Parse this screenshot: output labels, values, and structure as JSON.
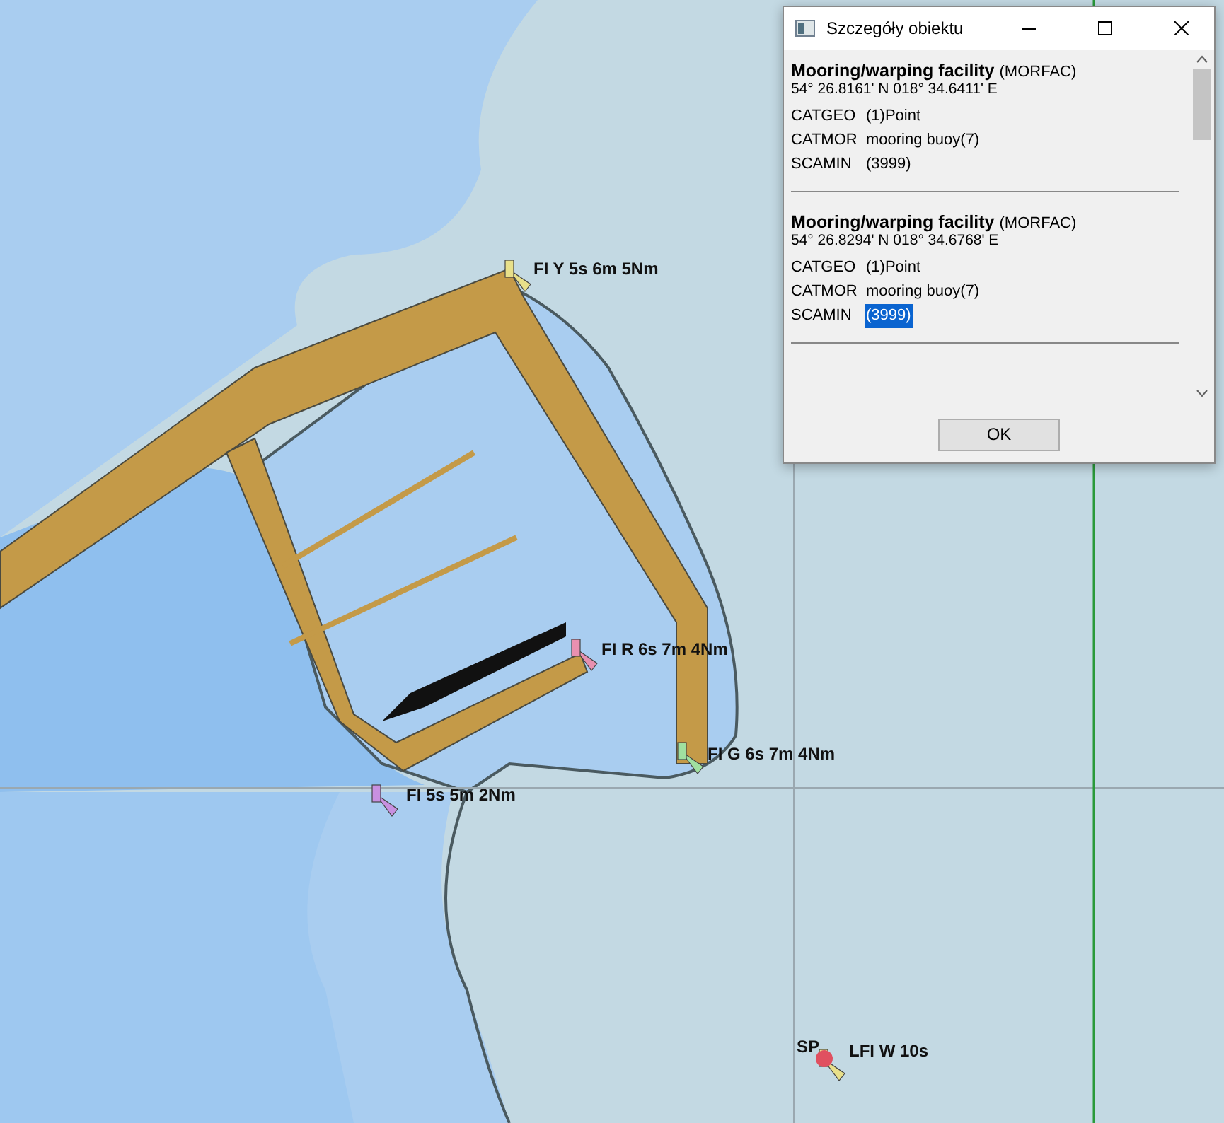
{
  "chart": {
    "lights": [
      {
        "label": "FI Y 5s 6m 5Nm",
        "color": "#e8e08a"
      },
      {
        "label": "FI R 6s 7m 4Nm",
        "color": "#e890b0"
      },
      {
        "label": "FI G 6s 7m 4Nm",
        "color": "#a0e0a0"
      },
      {
        "label": "FI  5s 5m 2Nm",
        "color": "#c890e0"
      },
      {
        "label": "LFI W 10s",
        "color": "#e8e08a"
      }
    ],
    "buoy": {
      "label": "SP",
      "color": "#e05060"
    }
  },
  "dialog": {
    "title": "Szczegóły obiektu",
    "records": [
      {
        "name": "Mooring/warping facility",
        "code": "(MORFAC)",
        "position": "54° 26.8161' N 018° 34.6411' E",
        "attributes": [
          {
            "key": "CATGEO",
            "value": "(1)Point",
            "selected": false
          },
          {
            "key": "CATMOR",
            "value": "mooring buoy(7)",
            "selected": false
          },
          {
            "key": "SCAMIN",
            "value": "(3999)",
            "selected": false
          }
        ]
      },
      {
        "name": "Mooring/warping facility",
        "code": "(MORFAC)",
        "position": "54° 26.8294' N 018° 34.6768' E",
        "attributes": [
          {
            "key": "CATGEO",
            "value": "(1)Point",
            "selected": false
          },
          {
            "key": "CATMOR",
            "value": "mooring buoy(7)",
            "selected": false
          },
          {
            "key": "SCAMIN",
            "value": "(3999)",
            "selected": true
          }
        ]
      }
    ],
    "ok_button": "OK"
  }
}
